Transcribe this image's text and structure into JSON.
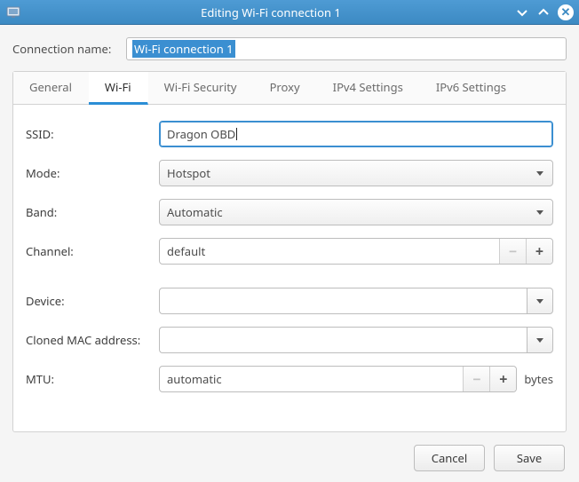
{
  "titlebar": {
    "title": "Editing Wi-Fi connection 1"
  },
  "connection_name": {
    "label": "Connection name:",
    "value": "Wi-Fi connection 1"
  },
  "tabs": [
    {
      "id": "general",
      "label": "General"
    },
    {
      "id": "wifi",
      "label": "Wi-Fi"
    },
    {
      "id": "security",
      "label": "Wi-Fi Security"
    },
    {
      "id": "proxy",
      "label": "Proxy"
    },
    {
      "id": "ipv4",
      "label": "IPv4 Settings"
    },
    {
      "id": "ipv6",
      "label": "IPv6 Settings"
    }
  ],
  "active_tab": "wifi",
  "wifi": {
    "ssid": {
      "label": "SSID:",
      "value": "Dragon OBD"
    },
    "mode": {
      "label": "Mode:",
      "value": "Hotspot"
    },
    "band": {
      "label": "Band:",
      "value": "Automatic"
    },
    "channel": {
      "label": "Channel:",
      "value": "default"
    },
    "device": {
      "label": "Device:",
      "value": ""
    },
    "cloned_mac": {
      "label": "Cloned MAC address:",
      "value": ""
    },
    "mtu": {
      "label": "MTU:",
      "value": "automatic",
      "suffix": "bytes"
    }
  },
  "buttons": {
    "cancel": "Cancel",
    "save": "Save"
  },
  "glyphs": {
    "minus": "−",
    "plus": "+",
    "times": "✕"
  }
}
